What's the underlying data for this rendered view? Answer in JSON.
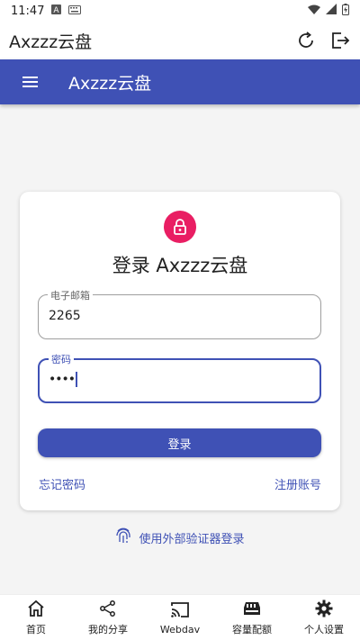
{
  "status_bar": {
    "time": "11:47",
    "battery_icon": "battery-icon",
    "wifi_icon": "wifi-icon",
    "signal_icon": "signal-icon"
  },
  "app_title_bar": {
    "title": "Axzzz云盘",
    "refresh_icon": "refresh-icon",
    "logout_icon": "logout-icon"
  },
  "toolbar": {
    "menu_icon": "menu-icon",
    "title": "Axzzz云盘",
    "color": "#3f51b5"
  },
  "login_card": {
    "lock_icon": "lock-icon",
    "lock_color": "#e91e63",
    "title": "登录 Axzzz云盘",
    "email": {
      "label": "电子邮箱",
      "value": "2265"
    },
    "password": {
      "label": "密码",
      "value": "••••"
    },
    "login_button": "登录",
    "forgot_password": "忘记密码",
    "register": "注册账号"
  },
  "external_login": {
    "icon": "fingerprint-icon",
    "label": "使用外部验证器登录"
  },
  "bottom_nav": {
    "items": [
      {
        "label": "首页",
        "icon": "home-icon"
      },
      {
        "label": "我的分享",
        "icon": "share-icon"
      },
      {
        "label": "Webdav",
        "icon": "cast-icon"
      },
      {
        "label": "容量配额",
        "icon": "storage-icon"
      },
      {
        "label": "个人设置",
        "icon": "gear-icon"
      }
    ]
  }
}
